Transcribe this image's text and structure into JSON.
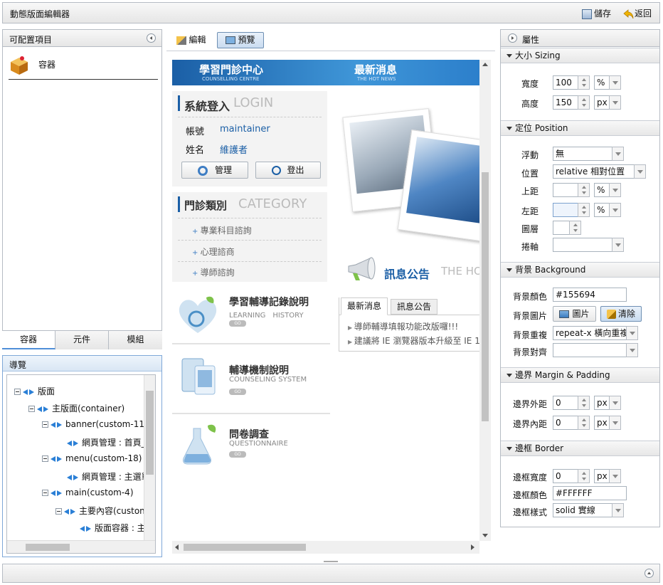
{
  "app": {
    "title": "動態版面編輯器",
    "save": "儲存",
    "back": "返回"
  },
  "left": {
    "title": "可配置項目",
    "item": "容器",
    "tabs": [
      "容器",
      "元件",
      "模組"
    ],
    "nav_title": "導覽",
    "tree": [
      "版面",
      "主版面(container)",
      "banner(custom-11",
      "網頁管理 : 首頁_",
      "menu(custom-18)",
      "網頁管理 : 主選單",
      "main(custom-4)",
      "主要內容(custon",
      "版面容器 : 主"
    ]
  },
  "toolbar": {
    "edit": "編輯",
    "preview": "預覽"
  },
  "preview": {
    "banner": {
      "t1": "學習門診中心",
      "s1": "COUNSELLING CENTRE",
      "t2": "最新消息",
      "s2": "THE HOT NEWS"
    },
    "login": {
      "title": "系統登入",
      "title_en": "LOGIN",
      "acct_label": "帳號",
      "acct": "maintainer",
      "name_label": "姓名",
      "name": "維護者",
      "manage": "管理",
      "logout": "登出"
    },
    "cat": {
      "title": "門診類別",
      "title_en": "CATEGORY",
      "items": [
        "專業科目諮詢",
        "心理諮商",
        "導師諮詢"
      ]
    },
    "promo": [
      {
        "t": "學習輔導記錄說明",
        "e": "LEARNING　HISTORY"
      },
      {
        "t": "輔導機制說明",
        "e": "COUNSELING SYSTEM"
      },
      {
        "t": "問卷調查",
        "e": "QUESTIONNAIRE"
      }
    ],
    "go": "GO",
    "notice": {
      "title": "訊息公告",
      "title_en": "THE HO",
      "tabs": [
        "最新消息",
        "訊息公告"
      ],
      "items": [
        "導師輔導填報功能改版囉!!!",
        "建議將 IE 瀏覽器版本升級至 IE 1"
      ]
    }
  },
  "props": {
    "title": "屬性",
    "sizing": {
      "title": "大小 Sizing",
      "w_label": "寬度",
      "w": "100",
      "w_unit": "%",
      "h_label": "高度",
      "h": "150",
      "h_unit": "px"
    },
    "pos": {
      "title": "定位 Position",
      "float_label": "浮動",
      "float": "無",
      "pos_label": "位置",
      "pos": "relative 相對位置",
      "top_label": "上距",
      "top_unit": "%",
      "left_label": "左距",
      "left_unit": "%",
      "z_label": "圖層",
      "ov_label": "捲軸"
    },
    "bg": {
      "title": "背景 Background",
      "color_label": "背景顏色",
      "color": "#155694",
      "img_label": "背景圖片",
      "img_btn": "圖片",
      "clear_btn": "清除",
      "rep_label": "背景重複",
      "rep": "repeat-x 橫向重複",
      "align_label": "背景對齊"
    },
    "margin": {
      "title": "邊界 Margin & Padding",
      "m_label": "邊界外距",
      "m": "0",
      "m_unit": "px",
      "p_label": "邊界內距",
      "p": "0",
      "p_unit": "px"
    },
    "border": {
      "title": "邊框 Border",
      "w_label": "邊框寬度",
      "w": "0",
      "w_unit": "px",
      "c_label": "邊框顏色",
      "c": "#FFFFFF",
      "s_label": "邊框樣式",
      "s": "solid 實線"
    }
  }
}
